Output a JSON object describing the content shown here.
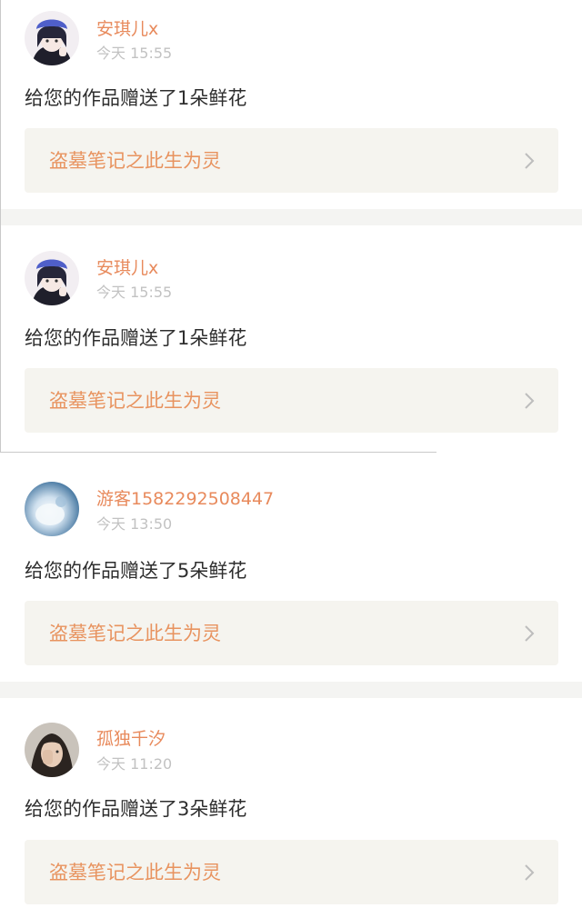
{
  "notifications": [
    {
      "username": "安琪儿x",
      "time": "今天 15:55",
      "message": "给您的作品赠送了1朵鲜花",
      "work_title": "盗墓笔记之此生为灵",
      "avatar_icon": "anime-girl-avatar-icon"
    },
    {
      "username": "安琪儿x",
      "time": "今天 15:55",
      "message": "给您的作品赠送了1朵鲜花",
      "work_title": "盗墓笔记之此生为灵",
      "avatar_icon": "anime-girl-avatar-icon"
    },
    {
      "username": "游客1582292508447",
      "time": "今天 13:50",
      "message": "给您的作品赠送了5朵鲜花",
      "work_title": "盗墓笔记之此生为灵",
      "avatar_icon": "blue-cloud-avatar-icon"
    },
    {
      "username": "孤独千汐",
      "time": "今天 11:20",
      "message": "给您的作品赠送了3朵鲜花",
      "work_title": "盗墓笔记之此生为灵",
      "avatar_icon": "photo-girl-avatar-icon"
    }
  ],
  "colors": {
    "username": "#e88a5c",
    "work_title": "#e8935f",
    "time": "#c2c2c2",
    "message": "#2e2e2e",
    "link_bg": "#f5f4ef",
    "separator": "#f4f4f2"
  }
}
